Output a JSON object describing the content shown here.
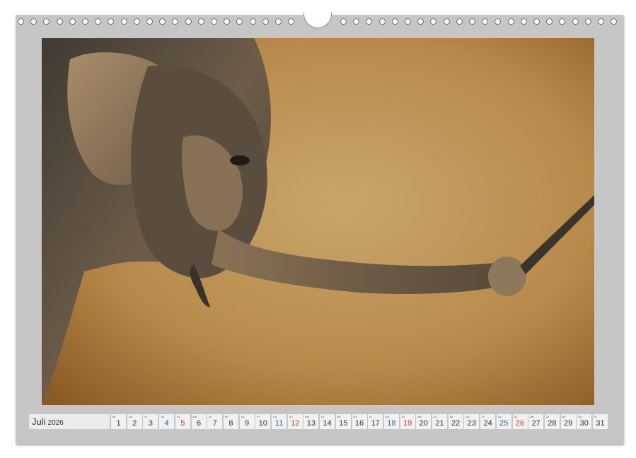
{
  "calendar": {
    "month": "Juli",
    "year": "2026",
    "days": [
      {
        "wd": "Mi",
        "num": "1",
        "type": "weekday"
      },
      {
        "wd": "Do",
        "num": "2",
        "type": "weekday"
      },
      {
        "wd": "Fr",
        "num": "3",
        "type": "weekday"
      },
      {
        "wd": "Sa",
        "num": "4",
        "type": "sat"
      },
      {
        "wd": "So",
        "num": "5",
        "type": "sun"
      },
      {
        "wd": "Mo",
        "num": "6",
        "type": "weekday"
      },
      {
        "wd": "Di",
        "num": "7",
        "type": "weekday"
      },
      {
        "wd": "Mi",
        "num": "8",
        "type": "weekday"
      },
      {
        "wd": "Do",
        "num": "9",
        "type": "weekday"
      },
      {
        "wd": "Fr",
        "num": "10",
        "type": "weekday"
      },
      {
        "wd": "Sa",
        "num": "11",
        "type": "sat"
      },
      {
        "wd": "So",
        "num": "12",
        "type": "sun"
      },
      {
        "wd": "Mo",
        "num": "13",
        "type": "weekday"
      },
      {
        "wd": "Di",
        "num": "14",
        "type": "weekday"
      },
      {
        "wd": "Mi",
        "num": "15",
        "type": "weekday"
      },
      {
        "wd": "Do",
        "num": "16",
        "type": "weekday"
      },
      {
        "wd": "Fr",
        "num": "17",
        "type": "weekday"
      },
      {
        "wd": "Sa",
        "num": "18",
        "type": "sat"
      },
      {
        "wd": "So",
        "num": "19",
        "type": "sun"
      },
      {
        "wd": "Mo",
        "num": "20",
        "type": "weekday"
      },
      {
        "wd": "Di",
        "num": "21",
        "type": "weekday"
      },
      {
        "wd": "Mi",
        "num": "22",
        "type": "weekday"
      },
      {
        "wd": "Do",
        "num": "23",
        "type": "weekday"
      },
      {
        "wd": "Fr",
        "num": "24",
        "type": "weekday"
      },
      {
        "wd": "Sa",
        "num": "25",
        "type": "sat"
      },
      {
        "wd": "So",
        "num": "26",
        "type": "sun"
      },
      {
        "wd": "Mo",
        "num": "27",
        "type": "weekday"
      },
      {
        "wd": "Di",
        "num": "28",
        "type": "weekday"
      },
      {
        "wd": "Mi",
        "num": "29",
        "type": "weekday"
      },
      {
        "wd": "Do",
        "num": "30",
        "type": "weekday"
      },
      {
        "wd": "Fr",
        "num": "31",
        "type": "weekday"
      }
    ]
  },
  "photo": {
    "subject": "elephant-photo",
    "colors": {
      "background_light": "#c9a56b",
      "background_dark": "#8a5a24",
      "skin_dark": "#3f3a33",
      "skin_mid": "#6d5c48",
      "skin_light": "#b39671"
    }
  },
  "colors": {
    "sheet": "#c6c6c6",
    "saturday": "#1d6a8f",
    "sunday": "#c0392b"
  }
}
